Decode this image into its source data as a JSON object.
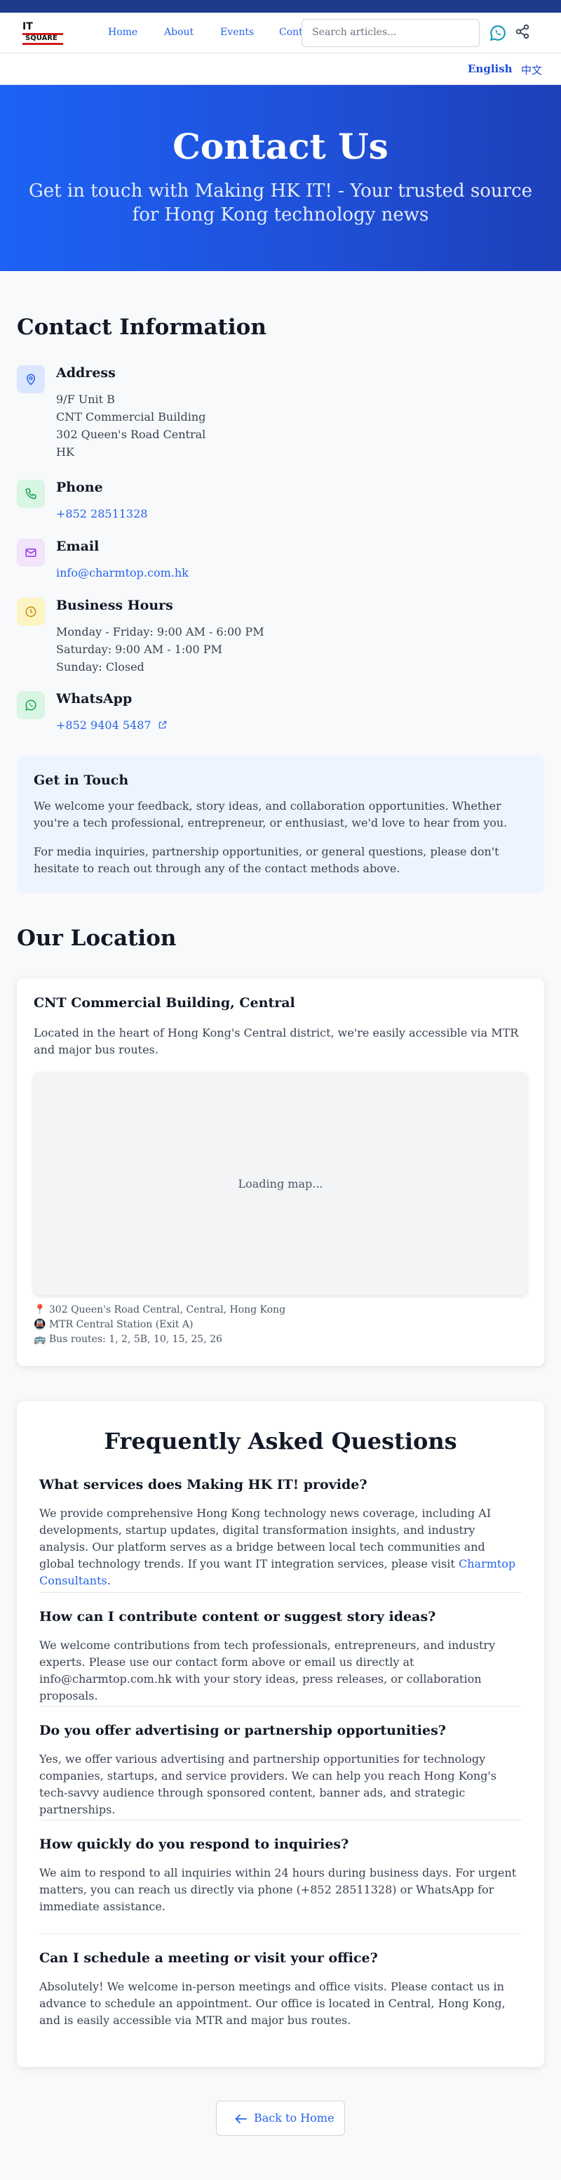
{
  "site": {
    "logo_line1": "IT",
    "logo_line2": "SQUARE"
  },
  "nav": {
    "items": [
      "Home",
      "About",
      "Events",
      "Cont"
    ],
    "search_placeholder": "Search articles..."
  },
  "icons": {
    "whatsapp": "whatsapp-icon",
    "share": "share-icon",
    "address": "map-pin-icon",
    "phone": "phone-icon",
    "email": "mail-icon",
    "hours": "clock-icon",
    "whatsapp_contact": "whatsapp-icon",
    "external": "external-link-icon",
    "back": "arrow-left-icon"
  },
  "lang": {
    "en": "English",
    "zh": "中文"
  },
  "hero": {
    "title": "Contact Us",
    "subtitle": "Get in touch with Making HK IT! - Your trusted source for Hong Kong technology news"
  },
  "contact": {
    "heading": "Contact Information",
    "address": {
      "title": "Address",
      "lines": [
        "9/F Unit B",
        "CNT Commercial Building",
        "302 Queen's Road Central",
        "HK"
      ]
    },
    "phone": {
      "title": "Phone",
      "value": "+852 28511328"
    },
    "email": {
      "title": "Email",
      "value": "info@charmtop.com.hk"
    },
    "hours": {
      "title": "Business Hours",
      "lines": [
        "Monday - Friday: 9:00 AM - 6:00 PM",
        "Saturday: 9:00 AM - 1:00 PM",
        "Sunday: Closed"
      ]
    },
    "whatsapp": {
      "title": "WhatsApp",
      "value": "+852 9404 5487"
    }
  },
  "touch": {
    "title": "Get in Touch",
    "p1": "We welcome your feedback, story ideas, and collaboration opportunities. Whether you're a tech professional, entrepreneur, or enthusiast, we'd love to hear from you.",
    "p2": "For media inquiries, partnership opportunities, or general questions, please don't hesitate to reach out through any of the contact methods above."
  },
  "location": {
    "heading": "Our Location",
    "card_title": "CNT Commercial Building, Central",
    "description": "Located in the heart of Hong Kong's Central district, we're easily accessible via MTR and major bus routes.",
    "map_loading": "Loading map...",
    "details": [
      {
        "emoji": "📍",
        "text": "302 Queen's Road Central, Central, Hong Kong"
      },
      {
        "emoji": "🚇",
        "text": "MTR Central Station (Exit A)"
      },
      {
        "emoji": "🚌",
        "text": "Bus routes: 1, 2, 5B, 10, 15, 25, 26"
      }
    ]
  },
  "faq": {
    "heading": "Frequently Asked Questions",
    "items": [
      {
        "q": "What services does Making HK IT! provide?",
        "a": "We provide comprehensive Hong Kong technology news coverage, including AI developments, startup updates, digital transformation insights, and industry analysis. Our platform serves as a bridge between local tech communities and global technology trends. If you want IT integration services, please visit ",
        "link": "Charmtop Consultants",
        "after": "."
      },
      {
        "q": "How can I contribute content or suggest story ideas?",
        "a": "We welcome contributions from tech professionals, entrepreneurs, and industry experts. Please use our contact form above or email us directly at info@charmtop.com.hk with your story ideas, press releases, or collaboration proposals."
      },
      {
        "q": "Do you offer advertising or partnership opportunities?",
        "a": "Yes, we offer various advertising and partnership opportunities for technology companies, startups, and service providers. We can help you reach Hong Kong's tech-savvy audience through sponsored content, banner ads, and strategic partnerships."
      },
      {
        "q": "How quickly do you respond to inquiries?",
        "a": "We aim to respond to all inquiries within 24 hours during business days. For urgent matters, you can reach us directly via phone (+852 28511328) or WhatsApp for immediate assistance."
      },
      {
        "q": "Can I schedule a meeting or visit your office?",
        "a": "Absolutely! We welcome in-person meetings and office visits. Please contact us in advance to schedule an appointment. Our office is located in Central, Hong Kong, and is easily accessible via MTR and major bus routes."
      }
    ]
  },
  "back_label": "Back to Home"
}
